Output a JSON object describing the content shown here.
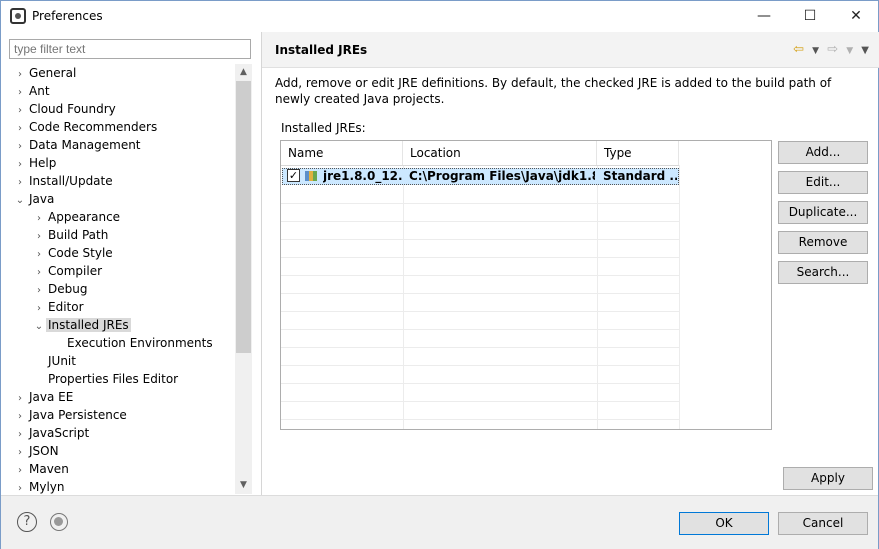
{
  "window": {
    "title": "Preferences",
    "minimize_glyph": "—",
    "maximize_glyph": "☐",
    "close_glyph": "✕"
  },
  "filter": {
    "placeholder": "type filter text"
  },
  "tree": {
    "items": [
      {
        "label": "General",
        "level": 0,
        "arrow": "›"
      },
      {
        "label": "Ant",
        "level": 0,
        "arrow": "›"
      },
      {
        "label": "Cloud Foundry",
        "level": 0,
        "arrow": "›"
      },
      {
        "label": "Code Recommenders",
        "level": 0,
        "arrow": "›"
      },
      {
        "label": "Data Management",
        "level": 0,
        "arrow": "›"
      },
      {
        "label": "Help",
        "level": 0,
        "arrow": "›"
      },
      {
        "label": "Install/Update",
        "level": 0,
        "arrow": "›"
      },
      {
        "label": "Java",
        "level": 0,
        "arrow": "⌄"
      },
      {
        "label": "Appearance",
        "level": 1,
        "arrow": "›"
      },
      {
        "label": "Build Path",
        "level": 1,
        "arrow": "›"
      },
      {
        "label": "Code Style",
        "level": 1,
        "arrow": "›"
      },
      {
        "label": "Compiler",
        "level": 1,
        "arrow": "›"
      },
      {
        "label": "Debug",
        "level": 1,
        "arrow": "›"
      },
      {
        "label": "Editor",
        "level": 1,
        "arrow": "›"
      },
      {
        "label": "Installed JREs",
        "level": 1,
        "arrow": "⌄",
        "selected": true
      },
      {
        "label": "Execution Environments",
        "level": 2,
        "arrow": ""
      },
      {
        "label": "JUnit",
        "level": 1,
        "arrow": ""
      },
      {
        "label": "Properties Files Editor",
        "level": 1,
        "arrow": ""
      },
      {
        "label": "Java EE",
        "level": 0,
        "arrow": "›"
      },
      {
        "label": "Java Persistence",
        "level": 0,
        "arrow": "›"
      },
      {
        "label": "JavaScript",
        "level": 0,
        "arrow": "›"
      },
      {
        "label": "JSON",
        "level": 0,
        "arrow": "›"
      },
      {
        "label": "Maven",
        "level": 0,
        "arrow": "›"
      },
      {
        "label": "Mylyn",
        "level": 0,
        "arrow": "›"
      }
    ]
  },
  "page": {
    "title": "Installed JREs",
    "description": "Add, remove or edit JRE definitions. By default, the checked JRE is added to the build path of newly created Java projects.",
    "installed_label": "Installed JREs:"
  },
  "table": {
    "columns": [
      "Name",
      "Location",
      "Type"
    ],
    "rows": [
      {
        "checked": true,
        "name": "jre1.8.0_12...",
        "location": "C:\\Program Files\\Java\\jdk1.8.0...",
        "type": "Standard ..."
      }
    ]
  },
  "buttons": {
    "add": "Add...",
    "edit": "Edit...",
    "duplicate": "Duplicate...",
    "remove": "Remove",
    "search": "Search...",
    "apply": "Apply",
    "ok": "OK",
    "cancel": "Cancel"
  },
  "icons": {
    "help": "?",
    "check": "✓"
  },
  "colors": {
    "selection": "#cce8ff",
    "default_button_border": "#0078d7"
  }
}
